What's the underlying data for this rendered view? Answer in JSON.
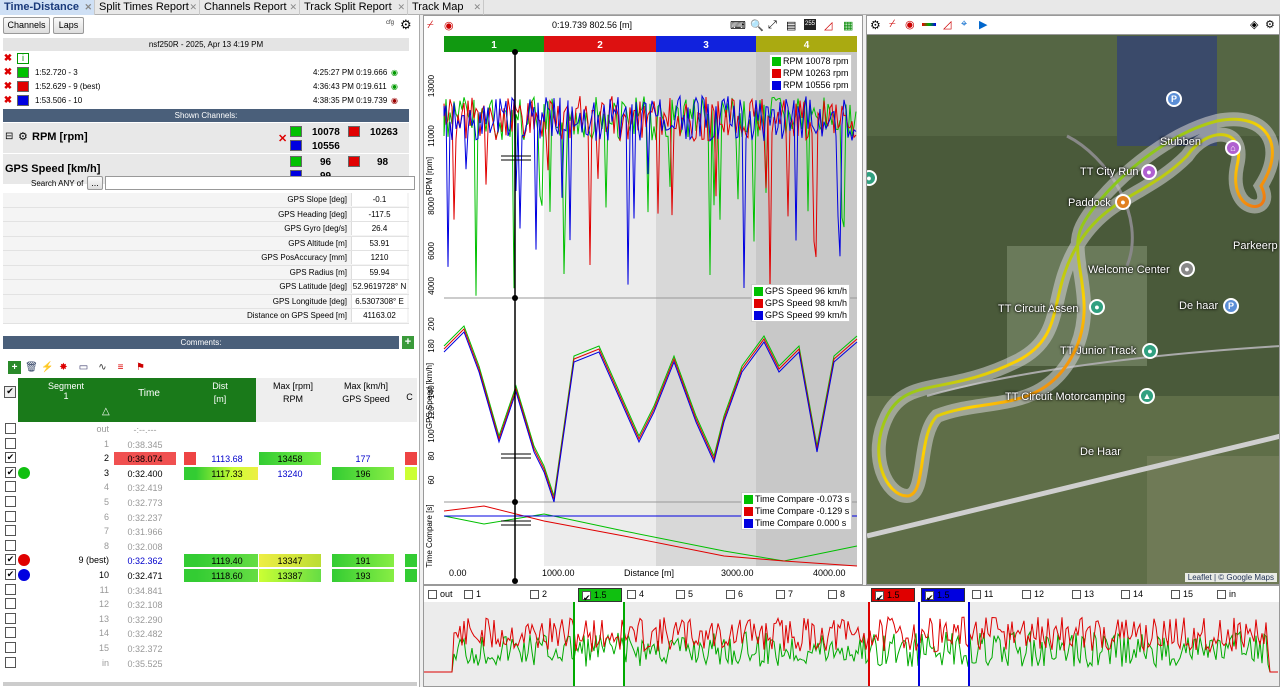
{
  "tabs": [
    {
      "label": "Time-Distance",
      "active": true
    },
    {
      "label": "Split Times Report",
      "active": false
    },
    {
      "label": "Channels Report",
      "active": false
    },
    {
      "label": "Track Split Report",
      "active": false
    },
    {
      "label": "Track Map",
      "active": false
    }
  ],
  "left": {
    "channels_btn": "Channels",
    "laps_btn": "Laps",
    "icon_cfg": "cfg",
    "session_title": "nsf250R - 2025, Apr 13 4:19 PM",
    "laps": [
      {
        "name": "1:52.720 - 3",
        "time": "4:25:27 PM 0:19.666",
        "color": "#00c000"
      },
      {
        "name": "1:52.629 - 9 (best)",
        "time": "4:36:43 PM 0:19.611",
        "color": "#e00000"
      },
      {
        "name": "1:53.506 - 10",
        "time": "4:38:35 PM 0:19.739",
        "color": "#0000e0"
      }
    ],
    "shown_channels_header": "Shown Channels:",
    "channels": [
      {
        "name": "RPM [rpm]",
        "v1": "10078",
        "v2": "10263",
        "v3": "10556"
      },
      {
        "name": "GPS Speed [km/h]",
        "v1": "96",
        "v2": "98",
        "v3": "99"
      }
    ],
    "search_label": "Search ANY of",
    "search_btn": "...",
    "search_value": "",
    "stats": [
      {
        "label": "GPS Slope [deg]",
        "value": "-0.1"
      },
      {
        "label": "GPS Heading [deg]",
        "value": "-117.5"
      },
      {
        "label": "GPS Gyro [deg/s]",
        "value": "26.4"
      },
      {
        "label": "GPS Altitude [m]",
        "value": "53.91"
      },
      {
        "label": "GPS PosAccuracy [mm]",
        "value": "1210"
      },
      {
        "label": "GPS Radius [m]",
        "value": "59.94"
      },
      {
        "label": "GPS Latitude [deg]",
        "value": "52.9619728° N"
      },
      {
        "label": "GPS Longitude [deg]",
        "value": "6.5307308° E"
      },
      {
        "label": "Distance on GPS Speed [m]",
        "value": "41163.02"
      }
    ],
    "comments_header": "Comments:",
    "comments_add": "+",
    "grid_headers": {
      "segment": "Segment",
      "segment_num": "1",
      "time": "Time",
      "sort": "△",
      "dist": "Dist",
      "dist_unit": "[m]",
      "maxrpm": "Max [rpm]",
      "maxrpm_unit": "RPM",
      "maxkmh": "Max [km/h]",
      "maxkmh_unit": "GPS Speed",
      "extra": "C"
    },
    "segments": [
      {
        "lap": "out",
        "time": "-:--.---",
        "checked": false,
        "dot": "",
        "dist": "",
        "rpm": "",
        "speed": ""
      },
      {
        "lap": "1",
        "time": "0:38.345",
        "checked": false,
        "dot": "",
        "dist": "",
        "rpm": "",
        "speed": ""
      },
      {
        "lap": "2",
        "time": "0:38.074",
        "checked": true,
        "dot": "",
        "dist": "1113.68",
        "rpm": "13458",
        "speed": "177",
        "timebg": "#f05050",
        "distcolor": "#0000cc",
        "speedcolor": "#0000cc"
      },
      {
        "lap": "3",
        "time": "0:32.400",
        "checked": true,
        "dot": "#10c010",
        "dist": "1117.33",
        "rpm": "13240",
        "speed": "196",
        "rpmcolor": "#0000cc"
      },
      {
        "lap": "4",
        "time": "0:32.419",
        "checked": false,
        "dot": "",
        "dist": "",
        "rpm": "",
        "speed": ""
      },
      {
        "lap": "5",
        "time": "0:32.773",
        "checked": false,
        "dot": "",
        "dist": "",
        "rpm": "",
        "speed": ""
      },
      {
        "lap": "6",
        "time": "0:32.237",
        "checked": false,
        "dot": "",
        "dist": "",
        "rpm": "",
        "speed": ""
      },
      {
        "lap": "7",
        "time": "0:31.966",
        "checked": false,
        "dot": "",
        "dist": "",
        "rpm": "",
        "speed": ""
      },
      {
        "lap": "8",
        "time": "0:32.008",
        "checked": false,
        "dot": "",
        "dist": "",
        "rpm": "",
        "speed": ""
      },
      {
        "lap": "9 (best)",
        "time": "0:32.362",
        "checked": true,
        "dot": "#e00000",
        "dist": "1119.40",
        "rpm": "13347",
        "speed": "191",
        "timecolor": "#0000cc"
      },
      {
        "lap": "10",
        "time": "0:32.471",
        "checked": true,
        "dot": "#0000e0",
        "dist": "1118.60",
        "rpm": "13387",
        "speed": "193"
      },
      {
        "lap": "11",
        "time": "0:34.841",
        "checked": false,
        "dot": "",
        "dist": "",
        "rpm": "",
        "speed": ""
      },
      {
        "lap": "12",
        "time": "0:32.108",
        "checked": false,
        "dot": "",
        "dist": "",
        "rpm": "",
        "speed": ""
      },
      {
        "lap": "13",
        "time": "0:32.290",
        "checked": false,
        "dot": "",
        "dist": "",
        "rpm": "",
        "speed": ""
      },
      {
        "lap": "14",
        "time": "0:32.482",
        "checked": false,
        "dot": "",
        "dist": "",
        "rpm": "",
        "speed": ""
      },
      {
        "lap": "15",
        "time": "0:32.372",
        "checked": false,
        "dot": "",
        "dist": "",
        "rpm": "",
        "speed": ""
      },
      {
        "lap": "in",
        "time": "0:35.525",
        "checked": false,
        "dot": "",
        "dist": "",
        "rpm": "",
        "speed": ""
      }
    ]
  },
  "chart": {
    "cursor_readout": "0:19.739 802.56 [m]",
    "sectors": [
      {
        "label": "1",
        "color": "#119911"
      },
      {
        "label": "2",
        "color": "#dd1111"
      },
      {
        "label": "3",
        "color": "#1122dd"
      },
      {
        "label": "4",
        "color": "#aaaa11"
      }
    ],
    "rpm_legend": [
      {
        "label": "RPM  10078  rpm",
        "color": "#00c000"
      },
      {
        "label": "RPM  10263  rpm",
        "color": "#e00000"
      },
      {
        "label": "RPM  10556  rpm",
        "color": "#0000e0"
      }
    ],
    "speed_legend": [
      {
        "label": "GPS Speed  96  km/h",
        "color": "#00c000"
      },
      {
        "label": "GPS Speed  98  km/h",
        "color": "#e00000"
      },
      {
        "label": "GPS Speed  99  km/h",
        "color": "#0000e0"
      }
    ],
    "tc_legend": [
      {
        "label": "Time Compare  -0.073  s",
        "color": "#00c000"
      },
      {
        "label": "Time Compare  -0.129  s",
        "color": "#e00000"
      },
      {
        "label": "Time Compare  0.000  s",
        "color": "#0000e0"
      }
    ],
    "rpm_axis_label": "RPM [rpm]",
    "speed_axis_label": "GPS Speed [km/h]",
    "tc_axis_label": "Time Compare [s]",
    "rpm_ticks": [
      "13000",
      "11000",
      "8000",
      "6000",
      "4000"
    ],
    "speed_ticks": [
      "200",
      "180",
      "140",
      "120",
      "100",
      "80",
      "60"
    ],
    "x_ticks": [
      "0.00",
      "1000.00",
      "3000.00",
      "4000.00"
    ],
    "x_label": "Distance [m]"
  },
  "map": {
    "labels": [
      "Stubben",
      "TT City Run",
      "Paddock",
      "Parkeerp",
      "Welcome Center",
      "De haar",
      "TT Circuit Assen",
      "TT Junior Track",
      "TT Circuit Motorcamping",
      "De Haar"
    ],
    "attribution": "Leaflet | © Google Maps"
  },
  "bottom": {
    "segments": [
      {
        "label": "out",
        "checked": false
      },
      {
        "label": "1",
        "checked": false
      },
      {
        "label": "2",
        "checked": false
      },
      {
        "label": "1.5",
        "checked": true,
        "bg": "#10c010"
      },
      {
        "label": "4",
        "checked": false
      },
      {
        "label": "5",
        "checked": false
      },
      {
        "label": "6",
        "checked": false
      },
      {
        "label": "7",
        "checked": false
      },
      {
        "label": "8",
        "checked": false
      },
      {
        "label": "1.5",
        "checked": true,
        "bg": "#e00000"
      },
      {
        "label": "1.5",
        "checked": true,
        "bg": "#0000e0"
      },
      {
        "label": "11",
        "checked": false
      },
      {
        "label": "12",
        "checked": false
      },
      {
        "label": "13",
        "checked": false
      },
      {
        "label": "14",
        "checked": false
      },
      {
        "label": "15",
        "checked": false
      },
      {
        "label": "in",
        "checked": false
      }
    ]
  }
}
